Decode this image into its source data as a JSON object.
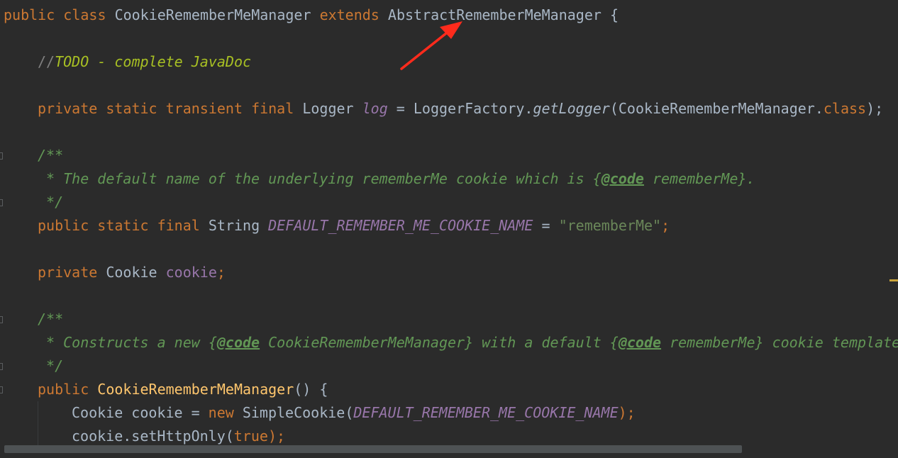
{
  "code": {
    "l1_kw1": "public",
    "l1_kw2": "class",
    "l1_name": "CookieRememberMeManager",
    "l1_kw3": "extends",
    "l1_super": "AbstractRememberMeManager",
    "l1_brace": "{",
    "l3_slashes": "//",
    "l3_todo": "TODO - complete JavaDoc",
    "l5_kw1": "private",
    "l5_kw2": "static",
    "l5_kw3": "transient",
    "l5_kw4": "final",
    "l5_type": "Logger",
    "l5_field": "log",
    "l5_eq": "=",
    "l5_factory": "LoggerFactory.",
    "l5_method": "getLogger",
    "l5_arg": "(CookieRememberMeManager.",
    "l5_classkw": "class",
    "l5_end": ");",
    "l7_open": "/**",
    "l8_text1": " * The default name of the underlying rememberMe cookie which is {",
    "l8_tag": "@code",
    "l8_text2": " rememberMe}.",
    "l9_close": " */",
    "l10_kw1": "public",
    "l10_kw2": "static",
    "l10_kw3": "final",
    "l10_type": "String",
    "l10_const": "DEFAULT_REMEMBER_ME_COOKIE_NAME",
    "l10_eq": "=",
    "l10_str": "\"rememberMe\"",
    "l10_semi": ";",
    "l12_kw": "private",
    "l12_type": "Cookie",
    "l12_field": "cookie",
    "l12_semi": ";",
    "l14_open": "/**",
    "l15_text1": " * Constructs a new {",
    "l15_tag1": "@code",
    "l15_text2": " CookieRememberMeManager} with a default {",
    "l15_tag2": "@code",
    "l15_text3": " rememberMe} cookie template",
    "l16_close": " */",
    "l17_kw": "public",
    "l17_ctor": "CookieRememberMeManager",
    "l17_rest": "() {",
    "l18_decl": "Cookie cookie = ",
    "l18_new": "new",
    "l18_call": " SimpleCookie(",
    "l18_const": "DEFAULT_REMEMBER_ME_COOKIE_NAME",
    "l18_end": ");",
    "l19_call": "cookie.setHttpOnly(",
    "l19_true": "true",
    "l19_end": ");"
  },
  "colors": {
    "background": "#2b2b2b",
    "keyword": "#cc7832",
    "doc_comment": "#629755",
    "todo": "#a8c023",
    "field": "#9876aa",
    "string": "#6a8759",
    "method_decl": "#ffc66d",
    "annotation_arrow": "#ff2b1c"
  },
  "icons": [
    "fold-marker-icon",
    "red-arrow-icon"
  ]
}
